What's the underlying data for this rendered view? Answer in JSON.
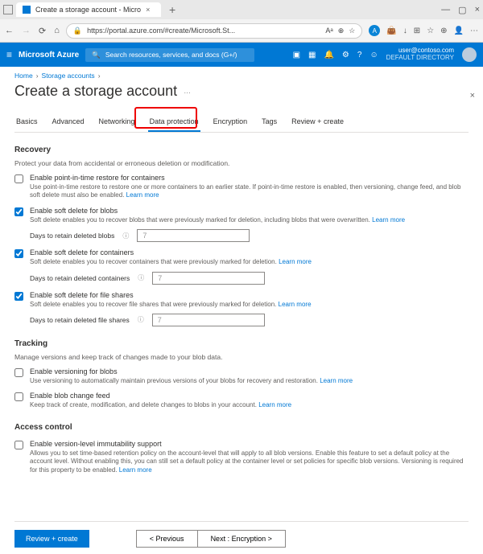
{
  "browser": {
    "tab_title": "Create a storage account - Micro",
    "url": "https://portal.azure.com/#create/Microsoft.St...",
    "aa_label": "Aᵃ"
  },
  "azure": {
    "brand": "Microsoft Azure",
    "search_placeholder": "Search resources, services, and docs (G+/)",
    "user_email": "user@contoso.com",
    "user_dir": "DEFAULT DIRECTORY"
  },
  "breadcrumb": {
    "home": "Home",
    "storage": "Storage accounts"
  },
  "page_title": "Create a storage account",
  "ellipsis": "…",
  "tabs": {
    "basics": "Basics",
    "advanced": "Advanced",
    "networking": "Networking",
    "data_protection": "Data protection",
    "encryption": "Encryption",
    "tags": "Tags",
    "review": "Review + create"
  },
  "recovery": {
    "heading": "Recovery",
    "desc": "Protect your data from accidental or erroneous deletion or modification.",
    "pitr": {
      "title": "Enable point-in-time restore for containers",
      "desc": "Use point-in-time restore to restore one or more containers to an earlier state. If point-in-time restore is enabled, then versioning, change feed, and blob soft delete must also be enabled.",
      "learn": "Learn more"
    },
    "sdb": {
      "title": "Enable soft delete for blobs",
      "desc": "Soft delete enables you to recover blobs that were previously marked for deletion, including blobs that were overwritten.",
      "learn": "Learn more",
      "days_label": "Days to retain deleted blobs",
      "days_value": "7"
    },
    "sdc": {
      "title": "Enable soft delete for containers",
      "desc": "Soft delete enables you to recover containers that were previously marked for deletion.",
      "learn": "Learn more",
      "days_label": "Days to retain deleted containers",
      "days_value": "7"
    },
    "sdf": {
      "title": "Enable soft delete for file shares",
      "desc": "Soft delete enables you to recover file shares that were previously marked for deletion.",
      "learn": "Learn more",
      "days_label": "Days to retain deleted file shares",
      "days_value": "7"
    }
  },
  "tracking": {
    "heading": "Tracking",
    "desc": "Manage versions and keep track of changes made to your blob data.",
    "versioning": {
      "title": "Enable versioning for blobs",
      "desc": "Use versioning to automatically maintain previous versions of your blobs for recovery and restoration.",
      "learn": "Learn more"
    },
    "changefeed": {
      "title": "Enable blob change feed",
      "desc": "Keep track of create, modification, and delete changes to blobs in your account.",
      "learn": "Learn more"
    }
  },
  "access": {
    "heading": "Access control",
    "immut": {
      "title": "Enable version-level immutability support",
      "desc": "Allows you to set time-based retention policy on the account-level that will apply to all blob versions. Enable this feature to set a default policy at the account level. Without enabling this, you can still set a default policy at the container level or set policies for specific blob versions. Versioning is required for this property to be enabled.",
      "learn": "Learn more"
    }
  },
  "buttons": {
    "review": "Review + create",
    "prev": "< Previous",
    "next": "Next : Encryption >"
  }
}
